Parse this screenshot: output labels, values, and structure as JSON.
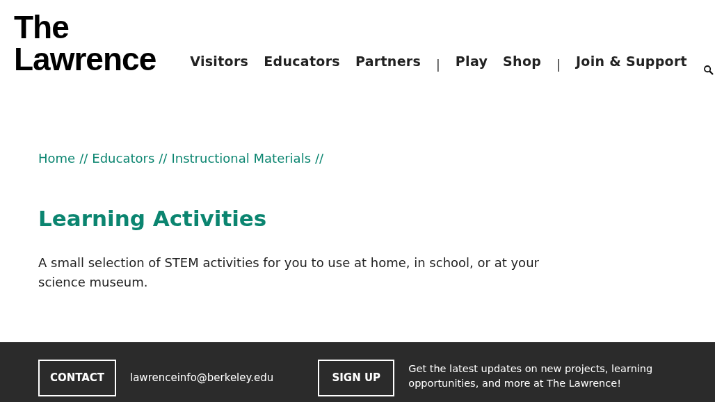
{
  "logo": {
    "lines": [
      "The",
      "Lawrence"
    ]
  },
  "nav": [
    {
      "kind": "link",
      "label": "Visitors"
    },
    {
      "kind": "link",
      "label": "Educators"
    },
    {
      "kind": "link",
      "label": "Partners"
    },
    {
      "kind": "separator",
      "label": "|"
    },
    {
      "kind": "link",
      "label": "Play"
    },
    {
      "kind": "link",
      "label": "Shop"
    },
    {
      "kind": "separator",
      "label": "|"
    },
    {
      "kind": "link",
      "label": "Join & Support"
    }
  ],
  "breadcrumbs": [
    {
      "label": "Home",
      "separator": "//"
    },
    {
      "label": "Educators",
      "separator": "//"
    },
    {
      "label": "Instructional Materials",
      "separator": "//"
    }
  ],
  "heading": "Learning Activities",
  "intro": "A small selection of STEM activities for you to use at home, in school, or at your science museum.",
  "footer": {
    "contact_button": "CONTACT",
    "email": "lawrenceinfo@berkeley.edu",
    "signup_button": "SIGN UP",
    "signup_text": "Get the latest updates on new projects, learning opportunities, and more at The Lawrence!"
  }
}
